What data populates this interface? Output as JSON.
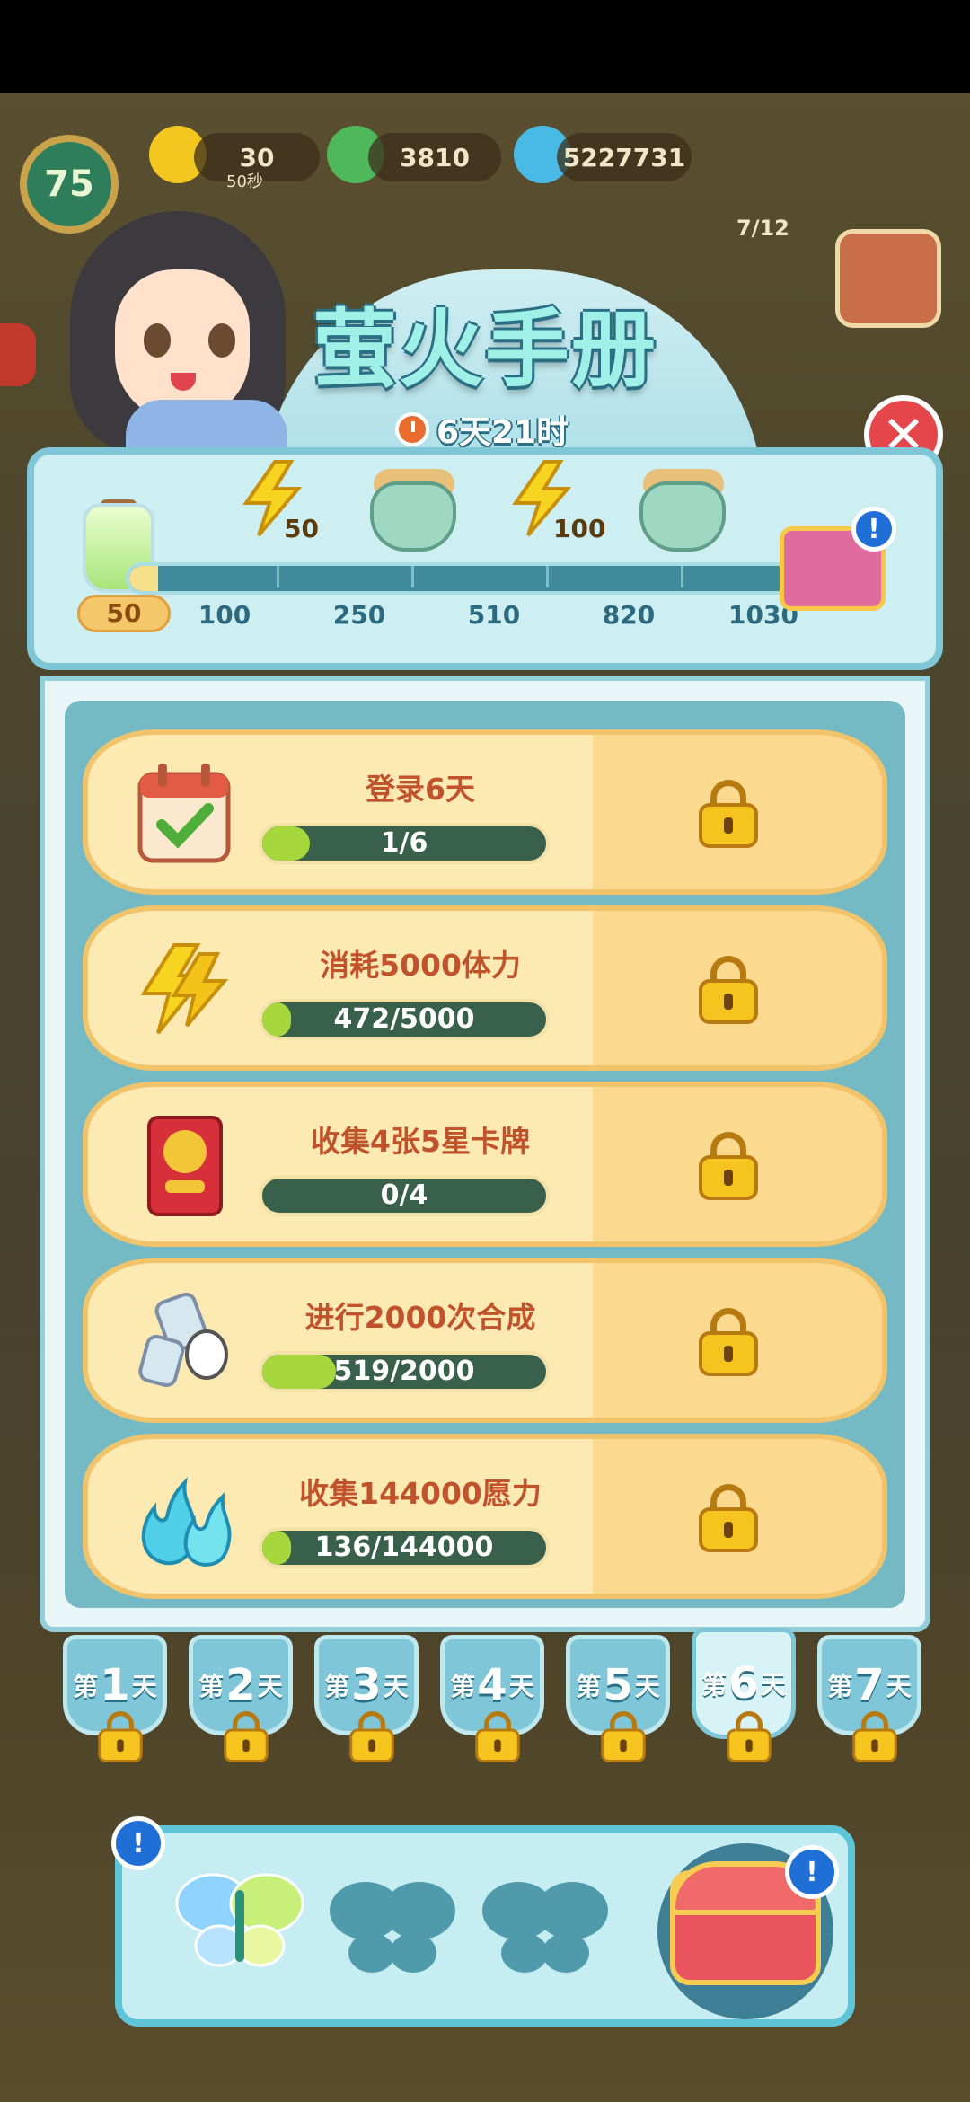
{
  "hud": {
    "level": "75",
    "energy": "30",
    "energy_sub": "50秒",
    "coins": "3810",
    "flame": "5227731",
    "event_counter": "7/12"
  },
  "header": {
    "title": "萤火手册",
    "timer": "6天21时"
  },
  "milestones": {
    "start_value": "50",
    "progress_fraction": 0.04,
    "values": [
      "100",
      "250",
      "510",
      "820",
      "1030"
    ],
    "rewards": [
      {
        "icon": "lightning-icon",
        "count": "50"
      },
      {
        "icon": "pot-icon",
        "count": ""
      },
      {
        "icon": "lightning-icon",
        "count": "100"
      },
      {
        "icon": "pot-icon",
        "count": ""
      },
      {
        "icon": "chest-icon",
        "count": ""
      }
    ]
  },
  "tasks": [
    {
      "title": "登录6天",
      "progress": "1/6",
      "fraction": 0.1667,
      "icon": "calendar-check-icon"
    },
    {
      "title": "消耗5000体力",
      "progress": "472/5000",
      "fraction": 0.0944,
      "icon": "lightning-icon"
    },
    {
      "title": "收集4张5星卡牌",
      "progress": "0/4",
      "fraction": 0,
      "icon": "card-pack-icon"
    },
    {
      "title": "进行2000次合成",
      "progress": "519/2000",
      "fraction": 0.2595,
      "icon": "merge-hand-icon"
    },
    {
      "title": "收集144000愿力",
      "progress": "136/144000",
      "fraction": 0.0009,
      "icon": "blue-flame-icon"
    }
  ],
  "days": {
    "prefix": "第",
    "suffix": "天",
    "numbers": [
      "1",
      "2",
      "3",
      "4",
      "5",
      "6",
      "7"
    ],
    "active_index": 5
  },
  "badge_mark": "!",
  "close_mark": "✕",
  "colors": {
    "accent_teal": "#75b9c5",
    "task_title": "#c0532b",
    "progress_fill": "#a6d83d",
    "close_red": "#e5464b"
  }
}
